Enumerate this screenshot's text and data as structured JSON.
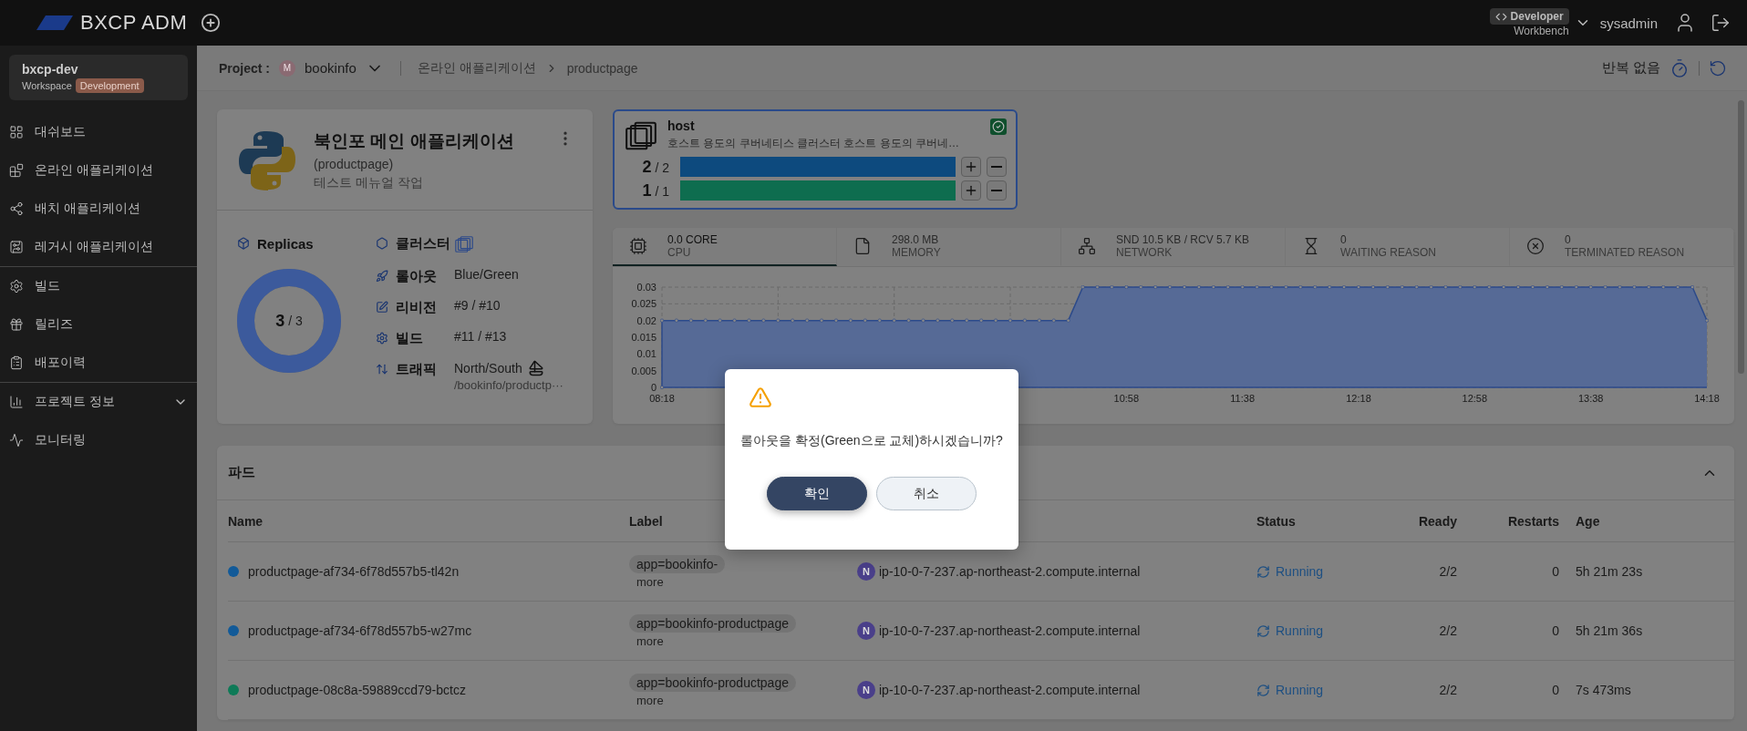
{
  "topbar": {
    "logo": "BXCP ADM",
    "role": {
      "badge": "Developer",
      "subtitle": "Workbench"
    },
    "user": "sysadmin"
  },
  "sidebar": {
    "workspace": {
      "name": "bxcp-dev",
      "label": "Workspace",
      "env": "Development"
    },
    "groups": [
      [
        {
          "label": "대쉬보드"
        },
        {
          "label": "온라인 애플리케이션"
        },
        {
          "label": "배치 애플리케이션"
        },
        {
          "label": "레거시 애플리케이션"
        }
      ],
      [
        {
          "label": "빌드"
        },
        {
          "label": "릴리즈"
        },
        {
          "label": "배포이력"
        }
      ],
      [
        {
          "label": "프로젝트 정보",
          "expanded": false
        },
        {
          "label": "모니터링"
        }
      ]
    ]
  },
  "breadcrumb": {
    "project_label": "Project :",
    "project_avatar": "M",
    "project": "bookinfo",
    "path": [
      "온라인 애플리케이션",
      "productpage"
    ],
    "repeat": "반복 없음"
  },
  "app_card": {
    "title": "북인포 메인 애플리케이션",
    "subtitle": "(productpage)",
    "description": "테스트 메뉴얼 작업",
    "replicas": {
      "label": "Replicas",
      "current": "3",
      "total": "/ 3",
      "level": 1
    },
    "details": [
      {
        "kind": "cluster",
        "label": "클러스터"
      },
      {
        "kind": "rollout",
        "label": "롤아웃",
        "value": "Blue/Green"
      },
      {
        "kind": "revision",
        "label": "리비전",
        "value": "#9 / #10"
      },
      {
        "kind": "build",
        "label": "빌드",
        "value": "#11 / #13"
      },
      {
        "kind": "traffic",
        "label": "트래픽",
        "value": "North/South",
        "sub": "/bookinfo/productp···"
      }
    ]
  },
  "host_card": {
    "name": "host",
    "description": "호스트 용도의 쿠버네티스 클러스터 호스트 용도의 쿠버네…",
    "checked": true,
    "bars": [
      {
        "current": "2",
        "total": "/ 2",
        "level": 1,
        "color": "#0d4a7e"
      },
      {
        "current": "1",
        "total": "/ 1",
        "level": 1,
        "color": "#0e6d4f"
      }
    ]
  },
  "metrics": {
    "tabs": [
      {
        "value": "0.0 CORE",
        "label": "CPU",
        "selected": true
      },
      {
        "value": "298.0 MB",
        "label": "MEMORY",
        "selected": false
      },
      {
        "value": "SND 10.5 KB / RCV 5.7 KB",
        "label": "NETWORK",
        "selected": false
      },
      {
        "value": "0",
        "label": "WAITING REASON",
        "selected": false
      },
      {
        "value": "0",
        "label": "TERMINATED REASON",
        "selected": false
      }
    ],
    "chart_data": {
      "type": "area",
      "grid": true,
      "ylim": [
        0,
        0.03
      ],
      "yticks": [
        0,
        0.005,
        0.01,
        0.015,
        0.02,
        0.025,
        0.03
      ],
      "categories": [
        "08:18",
        null,
        null,
        null,
        null,
        null,
        null,
        null,
        null,
        null,
        null,
        null,
        null,
        null,
        null,
        null,
        null,
        null,
        null,
        null,
        null,
        null,
        null,
        null,
        null,
        null,
        null,
        null,
        null,
        null,
        null,
        null,
        "10:58",
        null,
        null,
        null,
        null,
        null,
        null,
        null,
        "11:38",
        null,
        null,
        null,
        null,
        null,
        null,
        null,
        "12:18",
        null,
        null,
        null,
        null,
        null,
        null,
        null,
        "12:58",
        null,
        null,
        null,
        null,
        null,
        null,
        null,
        "13:38",
        null,
        null,
        null,
        null,
        null,
        null,
        null,
        "14:18"
      ],
      "series": [
        {
          "color": "#566a96",
          "values": [
            0.02,
            0.02,
            0.02,
            0.02,
            0.02,
            0.02,
            0.02,
            0.02,
            0.02,
            0.02,
            0.02,
            0.02,
            0.02,
            0.02,
            0.02,
            0.02,
            0.02,
            0.02,
            0.02,
            0.02,
            0.02,
            0.02,
            0.02,
            0.02,
            0.02,
            0.02,
            0.02,
            0.02,
            0.02,
            0.03,
            0.03,
            0.03,
            0.03,
            0.03,
            0.03,
            0.03,
            0.03,
            0.03,
            0.03,
            0.03,
            0.03,
            0.03,
            0.03,
            0.03,
            0.03,
            0.03,
            0.03,
            0.03,
            0.03,
            0.03,
            0.03,
            0.03,
            0.03,
            0.03,
            0.03,
            0.03,
            0.03,
            0.03,
            0.03,
            0.03,
            0.03,
            0.03,
            0.03,
            0.03,
            0.03,
            0.03,
            0.03,
            0.03,
            0.03,
            0.03,
            0.03,
            0.03,
            0.02
          ]
        }
      ]
    }
  },
  "pods": {
    "title": "파드",
    "expanded": true,
    "columns": [
      "Name",
      "Label",
      "Status",
      "Ready",
      "Restarts",
      "Age"
    ],
    "rows": [
      {
        "name": "productpage-af734-6f78d557b5-tl42n",
        "color": "#125a98",
        "label": "app=bookinfo-",
        "more": "more",
        "node_badge": "N",
        "node": "ip-10-0-7-237.ap-northeast-2.compute.internal",
        "status": "Running",
        "ready": "2/2",
        "restarts": "0",
        "age": "5h 21m 23s"
      },
      {
        "name": "productpage-af734-6f78d557b5-w27mc",
        "color": "#125a98",
        "label": "app=bookinfo-productpage",
        "more": "more",
        "node_badge": "N",
        "node": "ip-10-0-7-237.ap-northeast-2.compute.internal",
        "status": "Running",
        "ready": "2/2",
        "restarts": "0",
        "age": "5h 21m 36s"
      },
      {
        "name": "productpage-08c8a-59889ccd79-bctcz",
        "color": "#0e7a57",
        "label": "app=bookinfo-productpage",
        "more": "more",
        "node_badge": "N",
        "node": "ip-10-0-7-237.ap-northeast-2.compute.internal",
        "status": "Running",
        "ready": "2/2",
        "restarts": "0",
        "age": "7s 473ms"
      }
    ]
  },
  "modal": {
    "message": "롤아웃을 확정(Green으로 교체)하시겠습니까?",
    "buttons": [
      {
        "label": "확인",
        "kind": "primary"
      },
      {
        "label": "취소",
        "kind": "secondary"
      }
    ]
  }
}
